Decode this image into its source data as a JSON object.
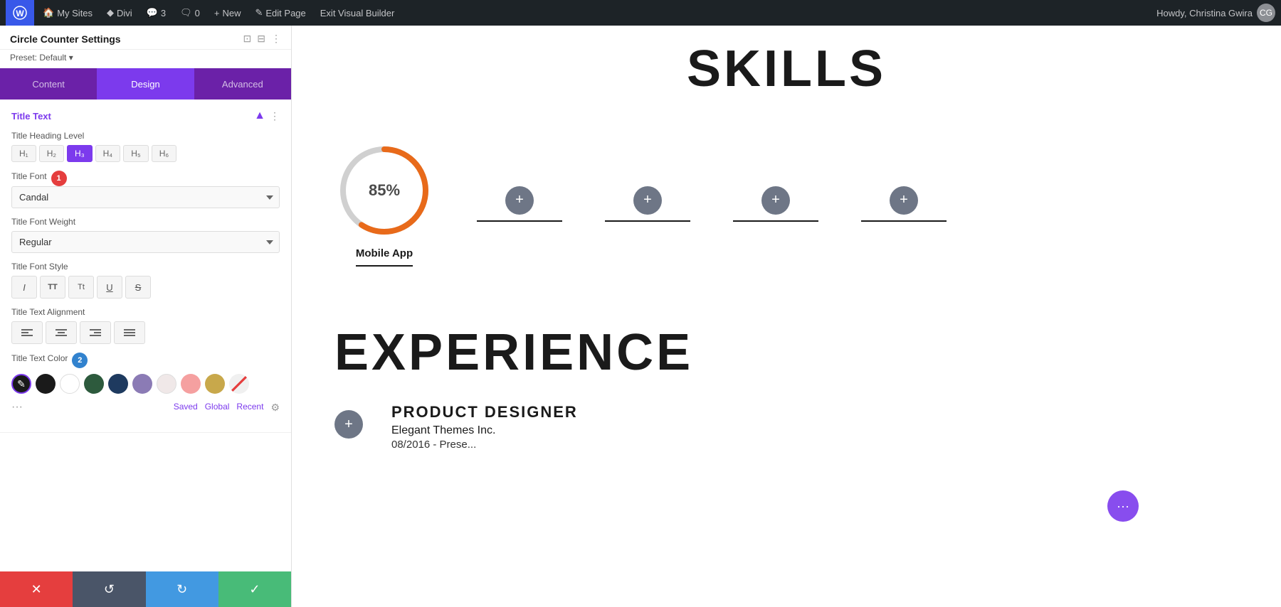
{
  "adminBar": {
    "wpLabel": "W",
    "mySites": "My Sites",
    "divi": "Divi",
    "comments": "3",
    "commentsCount": "0",
    "new": "New",
    "editPage": "Edit Page",
    "exitBuilder": "Exit Visual Builder",
    "user": "Howdy, Christina Gwira"
  },
  "panel": {
    "title": "Circle Counter Settings",
    "preset": "Preset: Default",
    "tabs": [
      {
        "id": "content",
        "label": "Content"
      },
      {
        "id": "design",
        "label": "Design"
      },
      {
        "id": "advanced",
        "label": "Advanced"
      }
    ],
    "activeTab": "design",
    "sections": {
      "titleText": {
        "label": "Title Text",
        "chevron": "▲",
        "headingLevel": {
          "label": "Title Heading Level",
          "options": [
            "H1",
            "H2",
            "H3",
            "H4",
            "H5",
            "H6"
          ],
          "active": 2
        },
        "titleFont": {
          "label": "Title Font",
          "badgeNumber": "1",
          "value": "Candal"
        },
        "titleFontWeight": {
          "label": "Title Font Weight",
          "value": "Regular"
        },
        "titleFontStyle": {
          "label": "Title Font Style",
          "buttons": [
            "I",
            "TT",
            "Tt",
            "U",
            "S"
          ]
        },
        "titleTextAlignment": {
          "label": "Title Text Alignment",
          "buttons": [
            "≡",
            "≡",
            "≡",
            "≡"
          ]
        },
        "titleTextColor": {
          "label": "Title Text Color",
          "badgeNumber": "2",
          "swatches": [
            {
              "id": "eyedropper",
              "type": "eyedropper",
              "color": "#1a1a1a"
            },
            {
              "id": "black",
              "color": "#1a1a1a"
            },
            {
              "id": "white",
              "color": "#ffffff"
            },
            {
              "id": "dark-green",
              "color": "#2d5a3d"
            },
            {
              "id": "dark-blue",
              "color": "#1e3a5f"
            },
            {
              "id": "medium-purple",
              "color": "#8b7bb5"
            },
            {
              "id": "light-pink",
              "color": "#f0e8e8"
            },
            {
              "id": "light-red",
              "color": "#f5a0a0"
            },
            {
              "id": "gold",
              "color": "#c8a84b"
            },
            {
              "id": "strikethrough",
              "type": "strikethrough"
            }
          ]
        },
        "colorFooter": {
          "saved": "Saved",
          "global": "Global",
          "recent": "Recent"
        }
      }
    },
    "bottomBar": {
      "cancel": "✕",
      "undo": "↺",
      "redo": "↻",
      "save": "✓"
    }
  },
  "canvas": {
    "skillsHeading": "SKILLS",
    "circleCounter": {
      "percentage": "85%",
      "label": "Mobile App",
      "circleColor": "#e86a1a",
      "trackColor": "#d0d0d0"
    },
    "addButtons": [
      {
        "id": "add-1"
      },
      {
        "id": "add-2"
      },
      {
        "id": "add-3"
      },
      {
        "id": "add-4"
      }
    ],
    "experienceHeading": "EXPERIENCE",
    "jobTitle": "PRODUCT DESIGNER",
    "company": "Elegant Themes Inc.",
    "dateRange": "08/2016 - Prese..."
  }
}
